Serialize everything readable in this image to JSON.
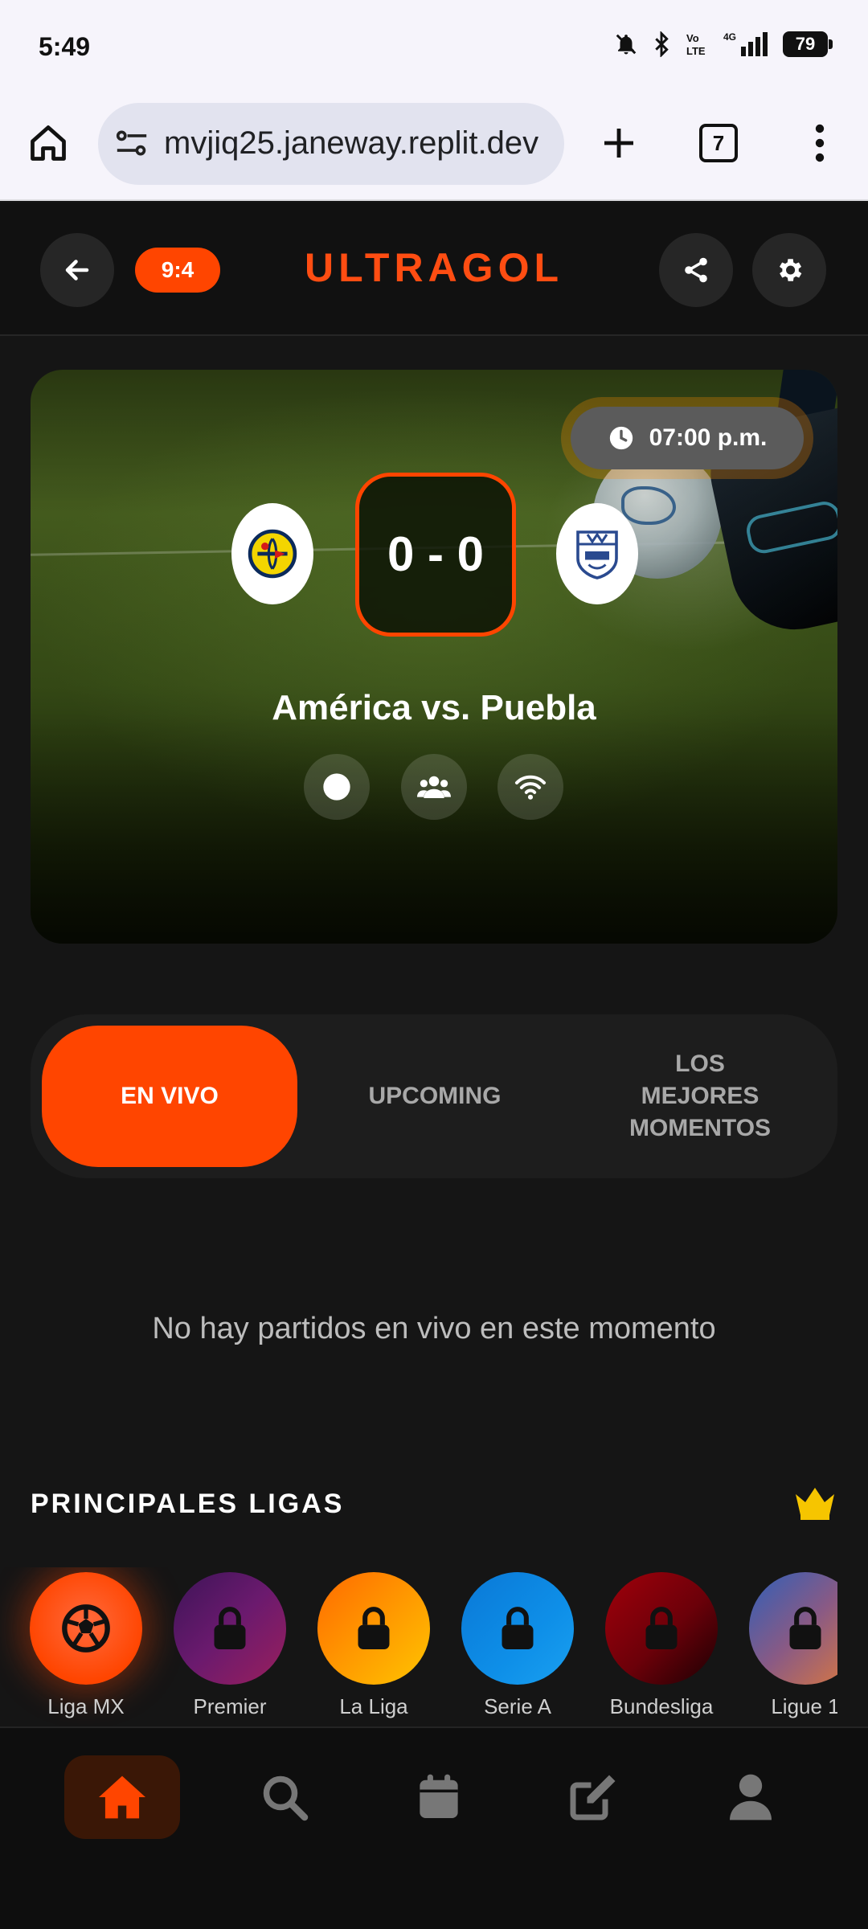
{
  "status_bar": {
    "time": "5:49",
    "battery": "79",
    "icons": [
      "bell-off-icon",
      "bluetooth-icon",
      "volte-icon",
      "4g-icon",
      "signal-icon",
      "battery-icon"
    ]
  },
  "browser": {
    "url": "mvjiq25.janeway.replit.dev",
    "tab_count": "7",
    "icons": [
      "home-icon",
      "site-settings-icon",
      "plus-icon",
      "more-vert-icon"
    ]
  },
  "header": {
    "badge": "9:4",
    "title": "ULTRAGOL",
    "icons": [
      "arrow-left-icon",
      "share-icon",
      "gear-icon"
    ]
  },
  "hero": {
    "time": "07:00 p.m.",
    "score": "0 - 0",
    "match_title": "América vs. Puebla",
    "home_team_logo": "america-logo",
    "away_team_logo": "puebla-logo",
    "icons": [
      "dot-icon",
      "users-icon",
      "wifi-icon"
    ]
  },
  "tabs": [
    {
      "label": "EN VIVO",
      "active": true
    },
    {
      "label": "UPCOMING",
      "active": false
    },
    {
      "label": "LOS MEJORES MOMENTOS",
      "active": false
    }
  ],
  "empty_message": "No hay partidos en vivo en este momento",
  "leagues": {
    "heading": "PRINCIPALES LIGAS",
    "crown_color": "#f6c500",
    "items": [
      {
        "name": "Liga MX",
        "icon": "soccer-ball-icon",
        "locked": false
      },
      {
        "name": "Premier",
        "icon": "lock-icon",
        "locked": true
      },
      {
        "name": "La Liga",
        "icon": "lock-icon",
        "locked": true
      },
      {
        "name": "Serie A",
        "icon": "lock-icon",
        "locked": true
      },
      {
        "name": "Bundesliga",
        "icon": "lock-icon",
        "locked": true
      },
      {
        "name": "Ligue 1",
        "icon": "lock-icon",
        "locked": true
      }
    ]
  },
  "bottom_nav": {
    "items": [
      "home",
      "search",
      "calendar",
      "edit",
      "profile"
    ],
    "active": "home",
    "accent_color": "#ff4500"
  }
}
